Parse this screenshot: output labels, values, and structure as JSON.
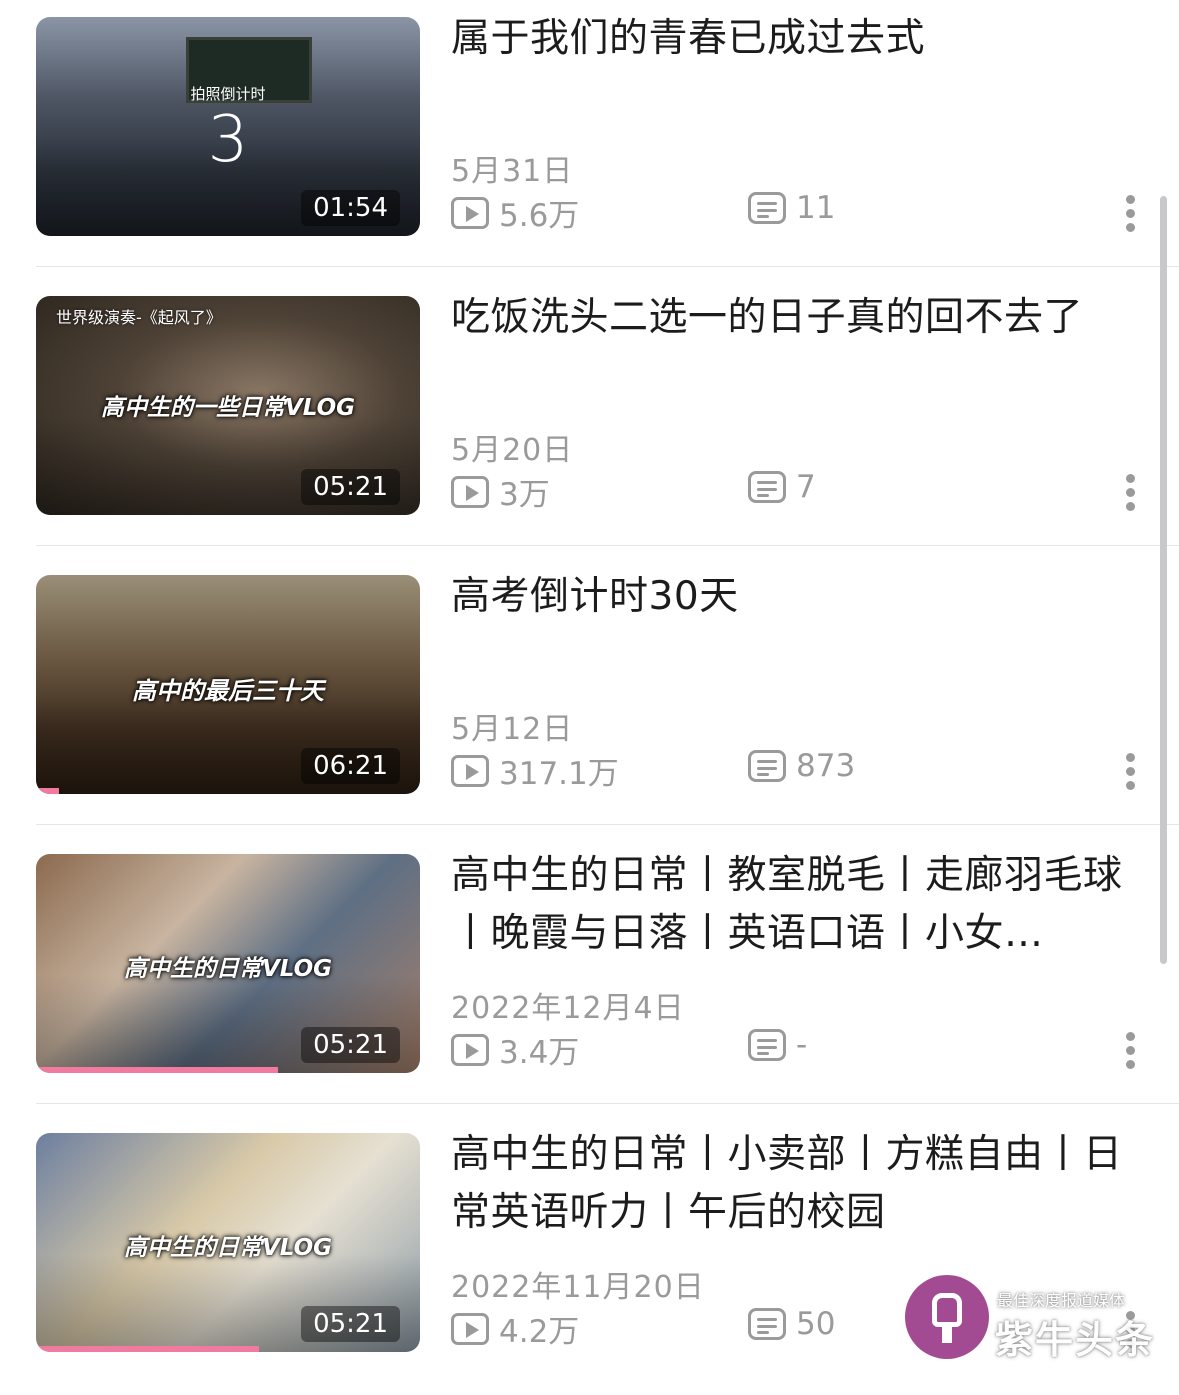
{
  "videos": [
    {
      "title": "属于我们的青春已成过去式",
      "date": "5月31日",
      "views": "5.6万",
      "comments": "11",
      "duration": "01:54",
      "thumb_overlay_small": "拍照倒计时",
      "thumb_overlay_big": "3",
      "watch_progress": 0
    },
    {
      "title": "吃饭洗头二选一的日子真的回不去了",
      "date": "5月20日",
      "views": "3万",
      "comments": "7",
      "duration": "05:21",
      "thumb_overlay_corner": "世界级演奏-《起风了》",
      "thumb_overlay_mid": "高中生的一些日常VLOG",
      "watch_progress": 0
    },
    {
      "title": "高考倒计时30天",
      "date": "5月12日",
      "views": "317.1万",
      "comments": "873",
      "duration": "06:21",
      "thumb_overlay_mid": "高中的最后三十天",
      "watch_progress": 0.06
    },
    {
      "title": "高中生的日常丨教室脱毛丨走廊羽毛球丨晚霞与日落丨英语口语丨小女…",
      "date": "2022年12月4日",
      "views": "3.4万",
      "comments": "-",
      "duration": "05:21",
      "thumb_overlay_mid": "高中生的日常VLOG",
      "watch_progress": 0.63
    },
    {
      "title": "高中生的日常丨小卖部丨方糕自由丨日常英语听力丨午后的校园",
      "date": "2022年11月20日",
      "views": "4.2万",
      "comments": "50",
      "duration": "05:21",
      "thumb_overlay_mid": "高中生的日常VLOG",
      "watch_progress": 0.58
    }
  ],
  "icons": {
    "views": "play-count-icon",
    "comments": "comment-icon",
    "more": "more-vertical-icon"
  },
  "watermark": {
    "subtitle": "最佳深度报道媒体",
    "brand": "紫牛头条"
  },
  "colors": {
    "progress": "#f07aa0",
    "meta_text": "#9a9a9a",
    "title_text": "#1c1c1c",
    "watermark_logo": "#9b3c89"
  }
}
